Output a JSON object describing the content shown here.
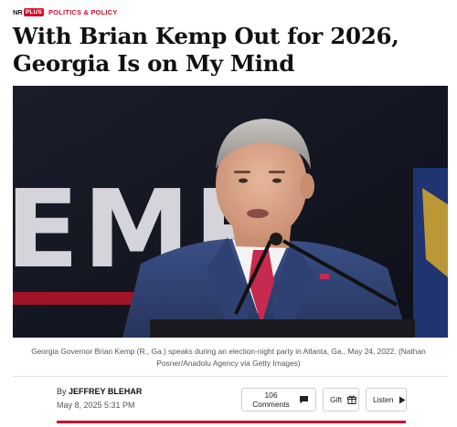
{
  "kicker": {
    "brand_nr": "NR",
    "brand_plus": "PLUS",
    "section": "POLITICS & POLICY"
  },
  "headline": "With Brian Kemp Out for 2026, Georgia Is on My Mind",
  "hero": {
    "backdrop_text": "EMP"
  },
  "caption": "Georgia Governor Brian Kemp (R., Ga.) speaks during an election-night party in Atlanta, Ga., May 24, 2022. (Nathan Posner/Anadolu Agency via Getty Images)",
  "byline": {
    "by_label": "By",
    "author": "JEFFREY BLEHAR",
    "date": "May 8, 2025 5:31 PM"
  },
  "actions": {
    "comments_label": "106 Comments",
    "gift_label": "Gift",
    "listen_label": "Listen"
  },
  "icons": {
    "comments": "comment-bubble-icon",
    "gift": "gift-icon",
    "listen": "play-icon"
  },
  "colors": {
    "accent": "#d0102c",
    "text": "#111111",
    "muted": "#555555",
    "border": "#cfcfcf"
  }
}
